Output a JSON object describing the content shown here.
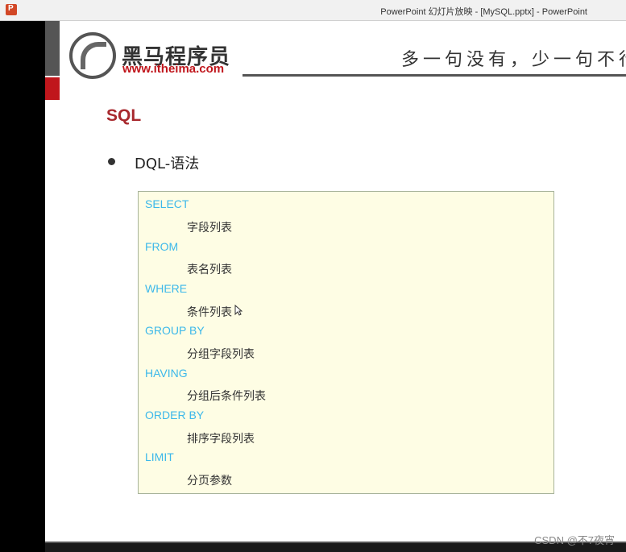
{
  "window": {
    "title": "PowerPoint 幻灯片放映 - [MySQL.pptx] - PowerPoint",
    "app_icon_letter": "P",
    "app_icon_color": "#d24726"
  },
  "slide": {
    "brand_name": "黑马程序员",
    "brand_url": "www.itheima.com",
    "slogan": "多一句没有，少一句不行",
    "heading": "SQL",
    "bullet": "DQL-语法",
    "accent_red": "#c0161c",
    "keyword_color": "#3cb8ea",
    "code": [
      {
        "keyword": "SELECT",
        "arg": "字段列表"
      },
      {
        "keyword": "FROM",
        "arg": "表名列表"
      },
      {
        "keyword": "WHERE",
        "arg": "条件列表"
      },
      {
        "keyword": "GROUP  BY",
        "arg": "分组字段列表"
      },
      {
        "keyword": "HAVING",
        "arg": "分组后条件列表"
      },
      {
        "keyword": "ORDER BY",
        "arg": "排序字段列表"
      },
      {
        "keyword": "LIMIT",
        "arg": "分页参数"
      }
    ]
  },
  "watermark": "CSDN @不7夜宵"
}
